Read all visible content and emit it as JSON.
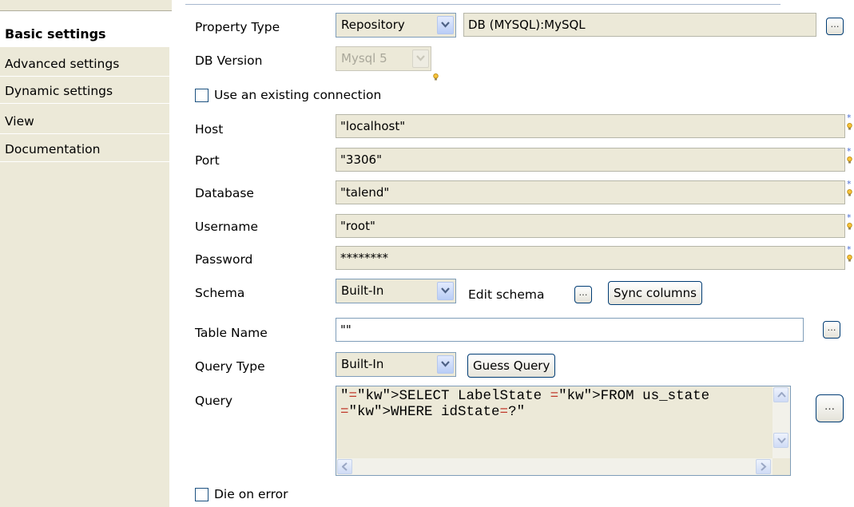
{
  "sidebar": {
    "items": [
      {
        "label": "Basic settings",
        "active": true
      },
      {
        "label": "Advanced settings"
      },
      {
        "label": "Dynamic settings"
      },
      {
        "label": "View"
      },
      {
        "label": "Documentation"
      }
    ]
  },
  "form": {
    "property_type": {
      "label": "Property Type",
      "mode": "Repository",
      "value": "DB (MYSQL):MySQL"
    },
    "db_version": {
      "label": "DB Version",
      "value": "Mysql 5"
    },
    "use_existing_connection": {
      "label": "Use an existing connection",
      "checked": false
    },
    "host": {
      "label": "Host",
      "value": "\"localhost\""
    },
    "port": {
      "label": "Port",
      "value": "\"3306\""
    },
    "database": {
      "label": "Database",
      "value": "\"talend\""
    },
    "username": {
      "label": "Username",
      "value": "\"root\""
    },
    "password": {
      "label": "Password",
      "value": "********"
    },
    "schema": {
      "label": "Schema",
      "mode": "Built-In",
      "edit_label": "Edit schema",
      "sync_label": "Sync columns"
    },
    "table_name": {
      "label": "Table Name",
      "value": "\"\""
    },
    "query_type": {
      "label": "Query Type",
      "mode": "Built-In",
      "guess_label": "Guess Query"
    },
    "query": {
      "label": "Query",
      "line1": "\"SELECT LabelState FROM us_state",
      "line2": "WHERE idState=?\""
    },
    "die_on_error": {
      "label": "Die on error",
      "checked": false
    }
  },
  "icons": {
    "ellipsis": "…",
    "required_marker": "*"
  },
  "colors": {
    "sidebar_bg": "#ece9d8",
    "field_bg": "#ece9d8",
    "keyword": "#2a1fa0",
    "accent_border": "#7f9db9"
  }
}
